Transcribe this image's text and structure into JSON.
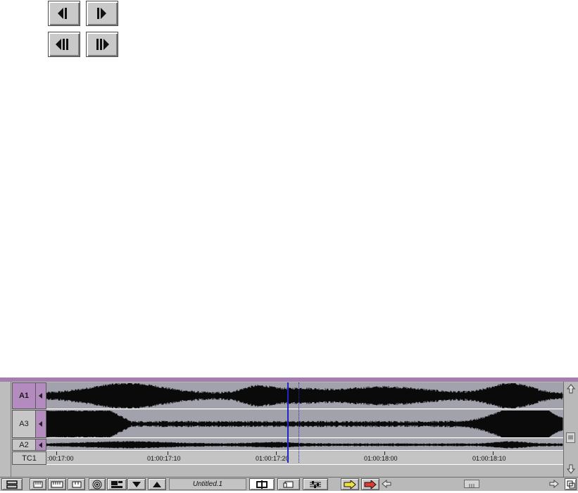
{
  "trim_controls": {
    "buttons": [
      {
        "name": "trim-left-1-frame",
        "icon": "trim-left-one-frame-icon"
      },
      {
        "name": "trim-right-1-frame",
        "icon": "trim-right-one-frame-icon"
      },
      {
        "name": "trim-left-10-frames",
        "icon": "trim-left-ten-frames-icon"
      },
      {
        "name": "trim-right-10-frames",
        "icon": "trim-right-ten-frames-icon"
      }
    ]
  },
  "timeline": {
    "tracks": [
      {
        "label": "A1",
        "selected": true
      },
      {
        "label": "A3",
        "selected": false
      },
      {
        "label": "A2",
        "selected": false
      },
      {
        "label": "TC1",
        "selected": false
      }
    ],
    "timecodes": [
      ":00:17:00",
      "01:00:17:10",
      "01:00:17:20",
      "01:00:18:00",
      "01:00:18:10"
    ],
    "sequence_name": "Untitled.1",
    "colors": {
      "selected_track": "#b48bbf",
      "position_indicator": "#2224c8",
      "track_background": "#a2a2ad"
    }
  }
}
